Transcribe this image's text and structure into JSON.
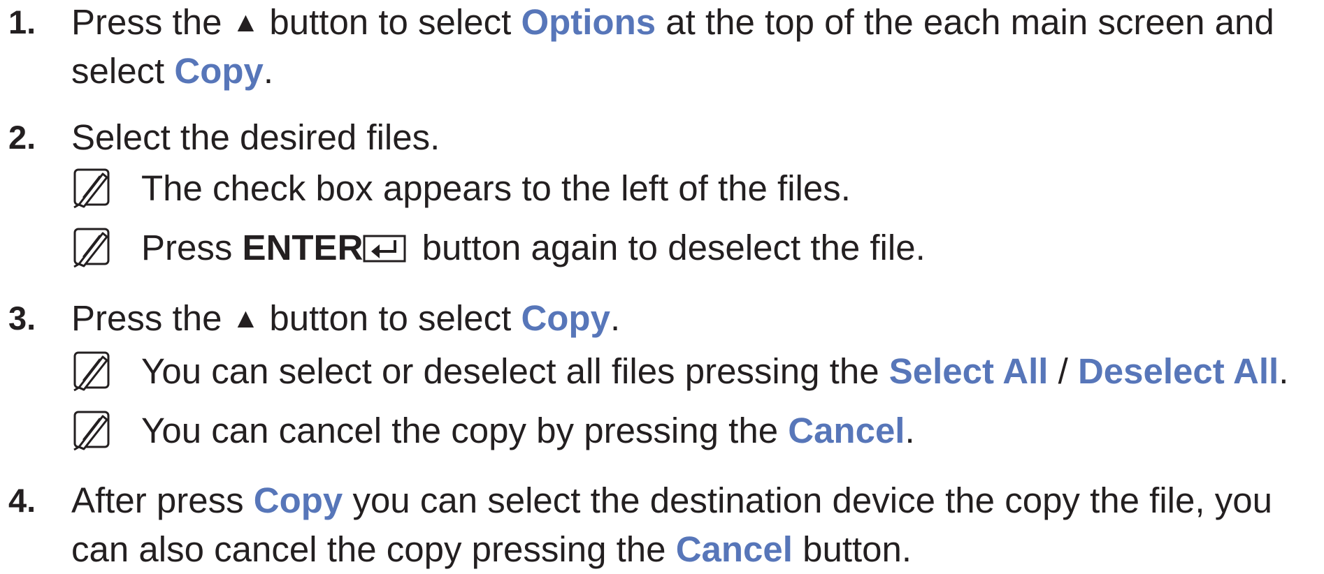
{
  "icons": {
    "note": "note-pencil-icon",
    "triangle": "up-triangle-icon",
    "enter": "enter-return-icon"
  },
  "colors": {
    "text": "#231f20",
    "highlight": "#5776b9"
  },
  "step1": {
    "number": "1.",
    "t1": "Press the",
    "tri": "▲",
    "t2": "button to select",
    "h1": "Options",
    "t3": "at the top of the each main screen and",
    "t4": "select",
    "h2": "Copy",
    "t5": "."
  },
  "step2": {
    "number": "2.",
    "t1": "Select the desired files.",
    "note1": "The check box appears to the left of the files.",
    "note2": {
      "t1": "Press",
      "b1": "ENTER",
      "t2": "button again to deselect the file."
    }
  },
  "step3": {
    "number": "3.",
    "t1": "Press the",
    "tri": "▲",
    "t2": "button to select",
    "h1": "Copy",
    "t3": ".",
    "note1": {
      "t1": "You can select or deselect all files pressing the",
      "h1": "Select All",
      "t2": "/",
      "h2": "Deselect All",
      "t3": "."
    },
    "note2": {
      "t1": "You can cancel the copy by pressing the",
      "h1": "Cancel",
      "t2": "."
    }
  },
  "step4": {
    "number": "4.",
    "t1": "After press",
    "h1": "Copy",
    "t2": "you can select the destination device the copy the file, you",
    "t3": "can also cancel the copy pressing the",
    "h2": "Cancel",
    "t4": "button."
  }
}
